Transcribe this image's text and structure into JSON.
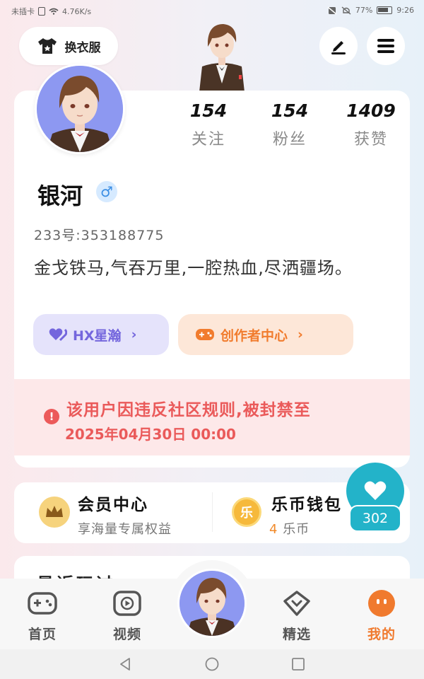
{
  "status_bar": {
    "carrier": "未插卡",
    "net_speed": "4.76K/s",
    "battery_percent": "77%",
    "time": "9:26"
  },
  "header": {
    "outfit_label": "换衣服",
    "icons": [
      "shirt-icon",
      "edit-icon",
      "menu-icon"
    ]
  },
  "profile": {
    "stats": [
      {
        "count": "154",
        "label": "关注"
      },
      {
        "count": "154",
        "label": "粉丝"
      },
      {
        "count": "1409",
        "label": "获赞"
      }
    ],
    "name": "银河",
    "gender_symbol": "♂",
    "uid": "233号:353188775",
    "bio": "金戈铁马,气吞万里,一腔热血,尽洒疆场。",
    "hx_label": "HX星瀚",
    "creator_label": "创作者中心",
    "chevron": "›"
  },
  "ban_notice": {
    "icon_glyph": "!",
    "message": "该用户因违反社区规则,被封禁至",
    "until": "2025年04月30日 00:00"
  },
  "membership": {
    "title": "会员中心",
    "subtitle": "享海量专属权益"
  },
  "wallet": {
    "title": "乐币钱包",
    "coin_glyph": "乐",
    "balance": "4",
    "unit": "乐币"
  },
  "like_float": {
    "count": "302"
  },
  "partial_section": {
    "title": "最近玩过"
  },
  "bottom_nav": {
    "items": [
      {
        "label": "首页",
        "icon": "gamepad-icon"
      },
      {
        "label": "视频",
        "icon": "video-play-icon"
      },
      {
        "label": "精选",
        "icon": "heart-box-icon"
      },
      {
        "label": "我的",
        "icon": "profile-face-icon"
      }
    ]
  },
  "colors": {
    "accent_orange": "#f07a2e",
    "ban_red": "#ea5a5a",
    "like_teal": "#23b3c9",
    "hx_purple": "#7466dd"
  }
}
